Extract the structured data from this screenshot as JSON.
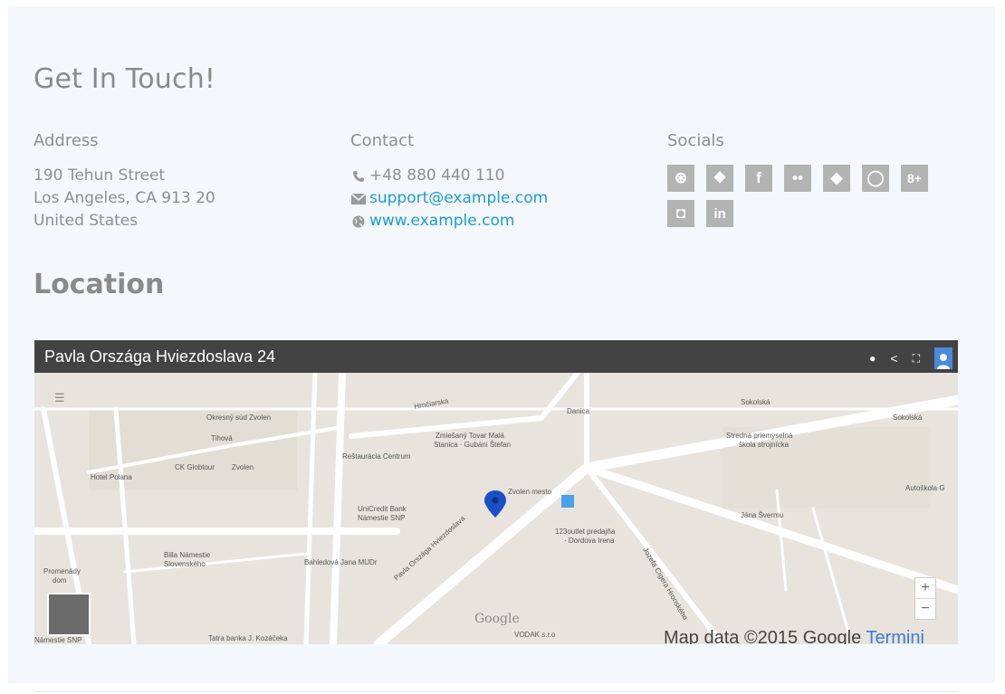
{
  "contact_section": {
    "heading": "Get In Touch!",
    "address": {
      "title": "Address",
      "lines": [
        "190 Tehun Street",
        "Los Angeles, CA 913 20",
        "United States"
      ]
    },
    "contact": {
      "title": "Contact",
      "phone": "+48 880 440 110",
      "email": "support@example.com",
      "website": "www.example.com"
    },
    "socials": {
      "title": "Socials",
      "icons": [
        {
          "name": "dribbble-icon",
          "glyph": "⊛"
        },
        {
          "name": "dropbox-icon",
          "glyph": "❖"
        },
        {
          "name": "facebook-icon",
          "glyph": "f"
        },
        {
          "name": "flickr-icon",
          "glyph": "••"
        },
        {
          "name": "foursquare-icon",
          "glyph": "◆"
        },
        {
          "name": "github-icon",
          "glyph": "◯"
        },
        {
          "name": "google-plus-icon",
          "glyph": "8+"
        },
        {
          "name": "instagram-icon",
          "glyph": "◘"
        },
        {
          "name": "linkedin-icon",
          "glyph": "in"
        }
      ]
    }
  },
  "location": {
    "heading": "Location",
    "map": {
      "title": "Pavla Országa Hviezdoslava 24",
      "attribution": "Map data ©2015 Google",
      "terms": "Termini",
      "logo": "Google",
      "zoom_in": "+",
      "zoom_out": "−",
      "labels": [
        "Okresný súd Zvolen",
        "Tihová",
        "CK Globtour",
        "Zvolen",
        "Hotel Polana",
        "Reštaurácia Centrum",
        "Zmiešaný Tovar Malá Stanica · Gubáni Štefan",
        "Danica",
        "Zvolen mesto",
        "Stredná priemyselná škola strojnícka",
        "Autoškola G",
        "Sokolská",
        "UniCredit Bank Námestie SNP",
        "123outlet predajňa · Dordova Irena",
        "Jána Švermu",
        "Billa Námestie Slovenského",
        "Bahledová Jana MUDr",
        "Pavla Országa Hviezdoslava",
        "Jozefa Cígera Hronského",
        "Tatra banka J. Kozáčeka",
        "Promenády dom",
        "Námestie SNP",
        "VODAK s.r.o",
        "Hrnčiarska",
        "Námestie SNP"
      ]
    }
  },
  "colors": {
    "background": "#f4f8fc",
    "link": "#1e9bd4",
    "muted_text": "#8e8e8e",
    "social_tile": "#b3b3b3",
    "map_bar": "#434343",
    "map_pin": "#1a4fc6"
  }
}
